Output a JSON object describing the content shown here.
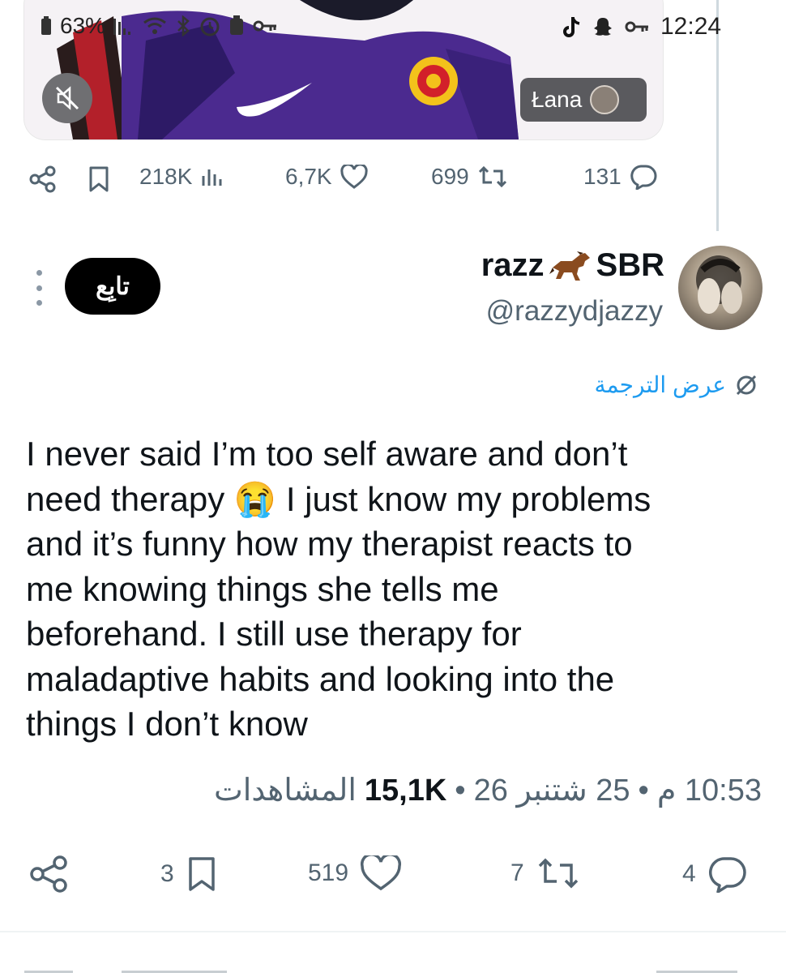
{
  "status_bar": {
    "battery": "63%",
    "time": "12:24"
  },
  "media": {
    "author_chip": "Łana"
  },
  "top_actions": {
    "views": "218K",
    "likes": "6,7K",
    "reposts": "699",
    "replies": "131"
  },
  "reply": {
    "follow_label": "تابِع",
    "display_name_left": "razz",
    "display_name_right": "SBR",
    "handle": "@razzydjazzy",
    "translate_label": "عرض الترجمة",
    "text": "I never said I’m too self aware and don’t\nneed therapy 😭 I just know my problems\nand it’s funny how my therapist reacts to\nme knowing things she tells me\nbeforehand. I still use therapy for\nmaladaptive habits and looking into the\nthings I don’t know",
    "meta": {
      "time": "10:53 م",
      "date": "25 شتنبر 26",
      "views_count": "15,1K",
      "views_label": "المشاهدات"
    },
    "actions": {
      "bookmarks": "3",
      "likes": "519",
      "reposts": "7",
      "replies": "4"
    }
  },
  "colors": {
    "text_primary": "#0f1419",
    "text_secondary": "#536471",
    "link_blue": "#1d9bf0",
    "jersey_purple": "#4b2a8f"
  }
}
